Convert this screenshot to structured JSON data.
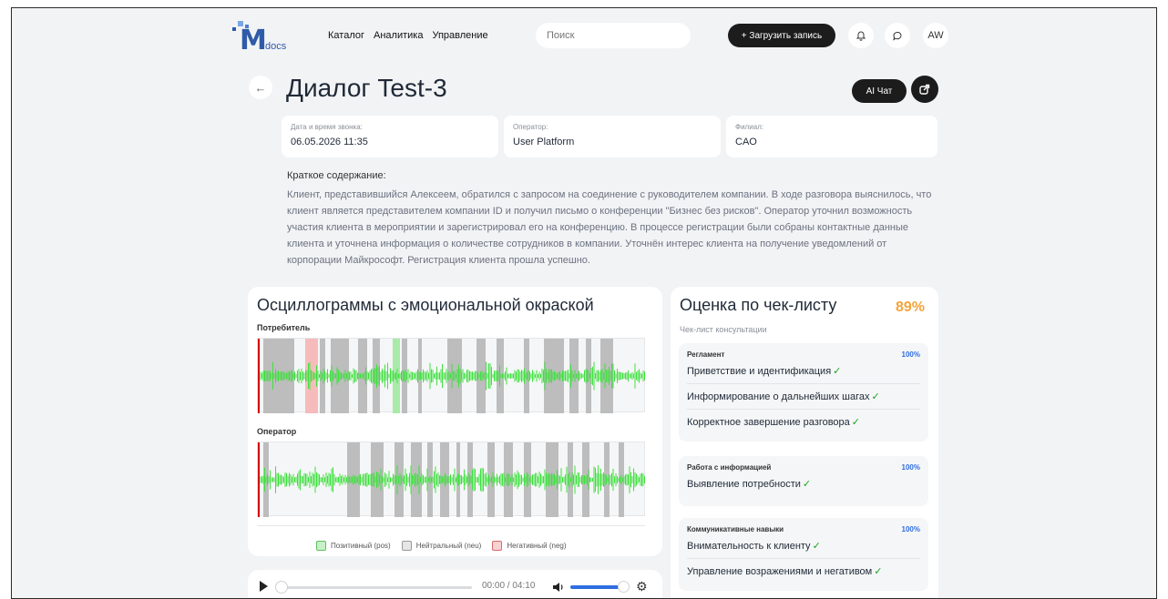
{
  "header": {
    "logo_text": "docs",
    "nav": [
      "Каталог",
      "Аналитика",
      "Управление"
    ],
    "search_placeholder": "Поиск",
    "upload_label": "+ Загрузить запись",
    "avatar_initials": "AW"
  },
  "page": {
    "title": "Диалог Test-3",
    "ai_chat_label": "AI Чат"
  },
  "info": {
    "datetime_label": "Дата и время звонка:",
    "datetime_value": "06.05.2026 11:35",
    "operator_label": "Оператор:",
    "operator_value": "User Platform",
    "branch_label": "Филиал:",
    "branch_value": "CAO"
  },
  "summary": {
    "title": "Краткое содержание:",
    "text": "Клиент, представившийся Алексеем, обратился с запросом на соединение с руководителем компании. В ходе разговора выяснилось, что клиент является представителем компании ID и получил письмо о конференции \"Бизнес без рисков\". Оператор уточнил возможность участия клиента в мероприятии и зарегистрировал его на конференцию. В процессе регистрации были собраны контактные данные клиента и уточнена информация о количестве сотрудников в компании. Уточнён интерес клиента на получение уведомлений от корпорации Майкрософт. Регистрация клиента прошла успешно."
  },
  "oscillogram": {
    "title": "Осциллограммы с эмоциональной окраской",
    "consumer_label": "Потребитель",
    "operator_label": "Оператор",
    "legend": [
      {
        "label": "Позитивный (pos)",
        "color": "#8ee08e"
      },
      {
        "label": "Нейтральный (neu)",
        "color": "#d7d7d7"
      },
      {
        "label": "Негативный (neg)",
        "color": "#f4a8a8"
      }
    ]
  },
  "player": {
    "time": "00:00 / 04:10"
  },
  "checklist": {
    "title": "Оценка по чек-листу",
    "score": "89%",
    "subtitle": "Чек-лист консультации",
    "sections": [
      {
        "name": "Регламент",
        "pct": "100%",
        "items": [
          "Приветствие и идентификация",
          "Информирование о дальнейших шагах",
          "Корректное завершение разговора"
        ]
      },
      {
        "name": "Работа с информацией",
        "pct": "100%",
        "items": [
          "Выявление потребности"
        ]
      },
      {
        "name": "Коммуникативные навыки",
        "pct": "100%",
        "items": [
          "Внимательность к клиенту",
          "Управление возражениями и негативом"
        ]
      }
    ]
  },
  "colors": {
    "accent_dark": "#1c1c1c",
    "score_orange": "#f2a43a",
    "pct_blue": "#2f6ee0",
    "check_green": "#19a51c"
  }
}
